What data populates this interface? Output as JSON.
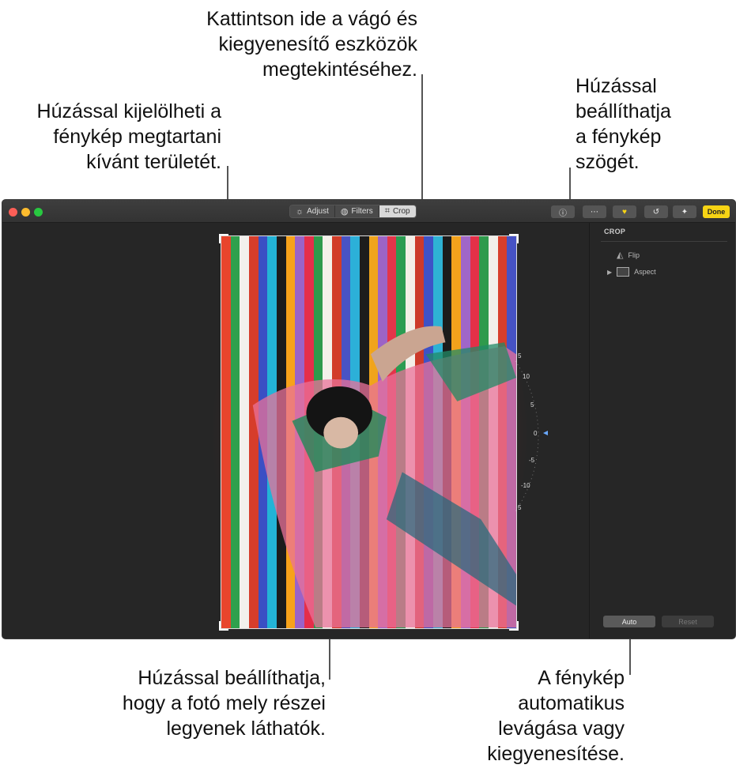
{
  "callouts": {
    "top_center": "Kattintson ide a vágó és\nkiegyenesítő eszközök\nmegtekintéséhez.",
    "top_left": "Húzással kijelölheti a\nfénykép megtartani\nkívánt területét.",
    "top_right": "Húzással\nbeállíthatja\na fénykép\nszögét.",
    "bottom_center": "Húzással beállíthatja,\nhogy a fotó mely részei\nlegyenek láthatók.",
    "bottom_right": "A fénykép\nautomatikus\nlevágása vagy\nkiegyenesítése."
  },
  "toolbar": {
    "modes": [
      {
        "label": "Adjust",
        "icon": "sun-icon",
        "active": false
      },
      {
        "label": "Filters",
        "icon": "filters-icon",
        "active": false
      },
      {
        "label": "Crop",
        "icon": "crop-icon",
        "active": true
      }
    ],
    "buttons": [
      {
        "name": "info-icon",
        "glyph": "ⓘ"
      },
      {
        "name": "more-icon",
        "glyph": "⋯"
      },
      {
        "name": "heart-icon",
        "glyph": "♥"
      },
      {
        "name": "rotate-icon",
        "glyph": "↺"
      },
      {
        "name": "magic-wand-icon",
        "glyph": "✦"
      }
    ],
    "done_label": "Done"
  },
  "dial": {
    "labels": [
      "5",
      "10",
      "5",
      "0",
      "-5",
      "-10",
      "5"
    ]
  },
  "sidebar": {
    "title": "CROP",
    "flip_label": "Flip",
    "aspect_label": "Aspect",
    "auto_label": "Auto",
    "reset_label": "Reset"
  },
  "photo": {
    "stripe_colors": [
      "#e8452c",
      "#2fa04d",
      "#f2f0ec",
      "#d63d2b",
      "#3a4fc4",
      "#23b3d6",
      "#1c1c1c",
      "#f7a21a",
      "#9a63c8",
      "#e52e4a",
      "#2e9a4c",
      "#f4f1ea",
      "#d23c28",
      "#4853c4",
      "#2cb0d8",
      "#1c1c1c",
      "#f0a41b",
      "#9c64c6",
      "#e4354a",
      "#2b9c52",
      "#f3efe8",
      "#cc3a2a",
      "#3e52c6",
      "#2eb2d4",
      "#1c1c1c",
      "#f3a21c",
      "#a066c8",
      "#e43048",
      "#2f9a4c",
      "#f2efe9",
      "#d73e2a",
      "#4652c4"
    ]
  }
}
